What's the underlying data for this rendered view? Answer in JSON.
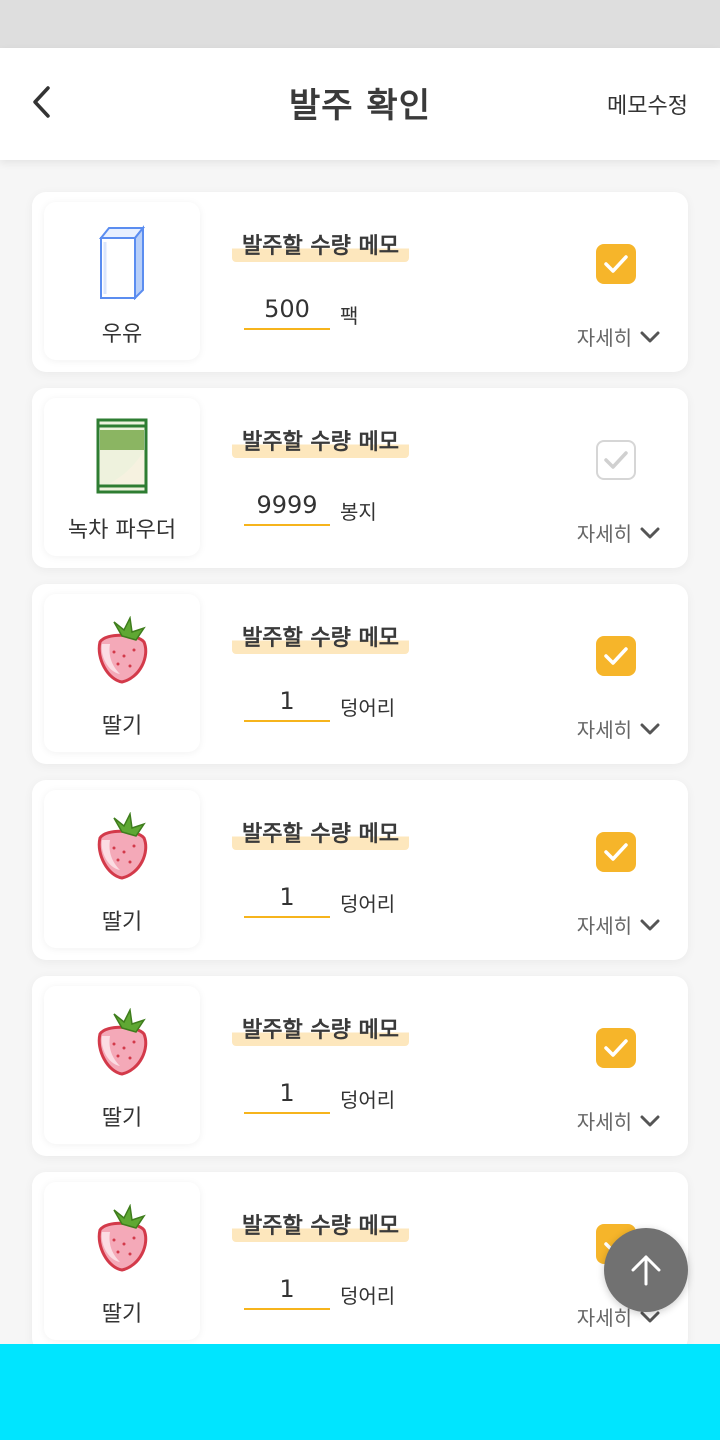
{
  "header": {
    "title": "발주 확인",
    "memo_edit_label": "메모수정"
  },
  "items": [
    {
      "name": "우유",
      "icon": "milk-carton-icon",
      "memo_label": "발주할 수량 메모",
      "quantity": "500",
      "unit": "팩",
      "checked": true,
      "detail_label": "자세히"
    },
    {
      "name": "녹차 파우더",
      "icon": "green-tea-powder-icon",
      "memo_label": "발주할 수량 메모",
      "quantity": "9999",
      "unit": "봉지",
      "checked": false,
      "detail_label": "자세히"
    },
    {
      "name": "딸기",
      "icon": "strawberry-icon",
      "memo_label": "발주할 수량 메모",
      "quantity": "1",
      "unit": "덩어리",
      "checked": true,
      "detail_label": "자세히"
    },
    {
      "name": "딸기",
      "icon": "strawberry-icon",
      "memo_label": "발주할 수량 메모",
      "quantity": "1",
      "unit": "덩어리",
      "checked": true,
      "detail_label": "자세히"
    },
    {
      "name": "딸기",
      "icon": "strawberry-icon",
      "memo_label": "발주할 수량 메모",
      "quantity": "1",
      "unit": "덩어리",
      "checked": true,
      "detail_label": "자세히"
    },
    {
      "name": "딸기",
      "icon": "strawberry-icon",
      "memo_label": "발주할 수량 메모",
      "quantity": "1",
      "unit": "덩어리",
      "checked": true,
      "detail_label": "자세히"
    }
  ],
  "colors": {
    "accent": "#f6b52a",
    "highlight": "#fde7bd",
    "bottom_bar": "#00e5ff",
    "fab": "#717171"
  },
  "fab": {
    "icon": "arrow-up-icon"
  }
}
